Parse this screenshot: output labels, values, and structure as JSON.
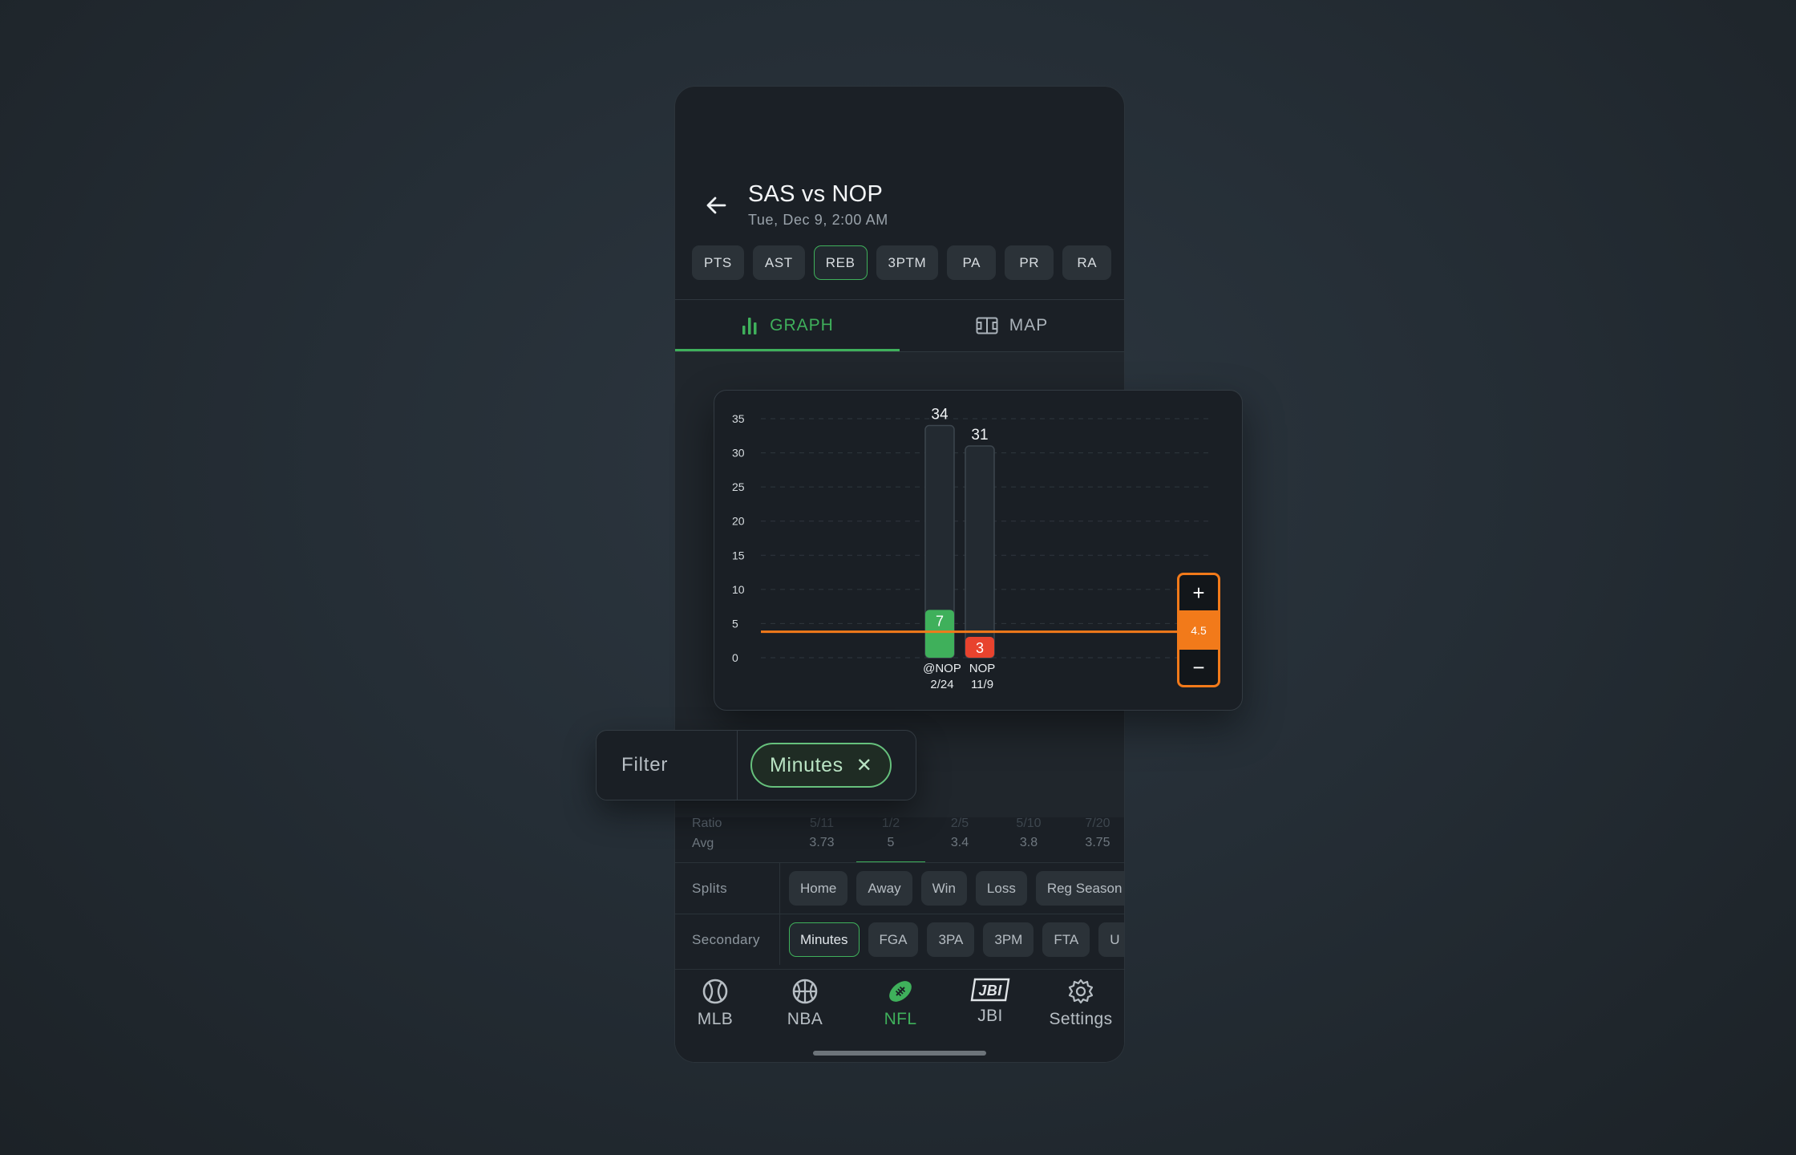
{
  "header": {
    "title": "SAS vs NOP",
    "subtitle": "Tue, Dec 9, 2:00 AM"
  },
  "stat_chips": [
    "PTS",
    "AST",
    "REB",
    "3PTM",
    "PA",
    "PR",
    "RA"
  ],
  "active_stat": "REB",
  "tabs": {
    "graph": "GRAPH",
    "map": "MAP"
  },
  "chart_data": {
    "type": "bar",
    "categories": [
      "@NOP 2/24",
      "NOP 11/9"
    ],
    "category_lines": [
      [
        "@NOP",
        "2/24"
      ],
      [
        "NOP",
        "11/9"
      ]
    ],
    "series": [
      {
        "values": [
          7,
          3
        ],
        "colors": [
          "#3fb05b",
          "#e8432e"
        ]
      },
      {
        "values": [
          34,
          31
        ]
      }
    ],
    "yticks": [
      "0",
      "5",
      "10",
      "15",
      "20",
      "25",
      "30",
      "35"
    ],
    "ylim": [
      0,
      35
    ],
    "line_value": 4.5,
    "line_color": "#f27a1a",
    "grid": true
  },
  "stepper": {
    "plus": "+",
    "value": "4.5",
    "minus": "−"
  },
  "filter": {
    "label": "Filter",
    "pill": "Minutes",
    "clear_icon": "✕"
  },
  "ratio": {
    "ratio_label": "Ratio",
    "avg_label": "Avg",
    "columns": [
      {
        "ratio": "5/11",
        "avg": "3.73"
      },
      {
        "ratio": "1/2",
        "avg": "5"
      },
      {
        "ratio": "2/5",
        "avg": "3.4"
      },
      {
        "ratio": "5/10",
        "avg": "3.8"
      },
      {
        "ratio": "7/20",
        "avg": "3.75"
      }
    ]
  },
  "splits": {
    "label": "Splits",
    "items": [
      "Home",
      "Away",
      "Win",
      "Loss",
      "Reg Season"
    ]
  },
  "secondary": {
    "label": "Secondary",
    "items": [
      "Minutes",
      "FGA",
      "3PA",
      "3PM",
      "FTA",
      "U"
    ]
  },
  "nav": [
    {
      "label": "MLB",
      "icon": "baseball-icon"
    },
    {
      "label": "NBA",
      "icon": "basketball-icon"
    },
    {
      "label": "NFL",
      "icon": "football-icon"
    },
    {
      "label": "JBI",
      "icon": "jbi-logo-icon"
    },
    {
      "label": "Settings",
      "icon": "gear-icon"
    }
  ],
  "colors": {
    "accent": "#3fb05b",
    "line": "#f27a1a",
    "miss": "#e8432e"
  }
}
